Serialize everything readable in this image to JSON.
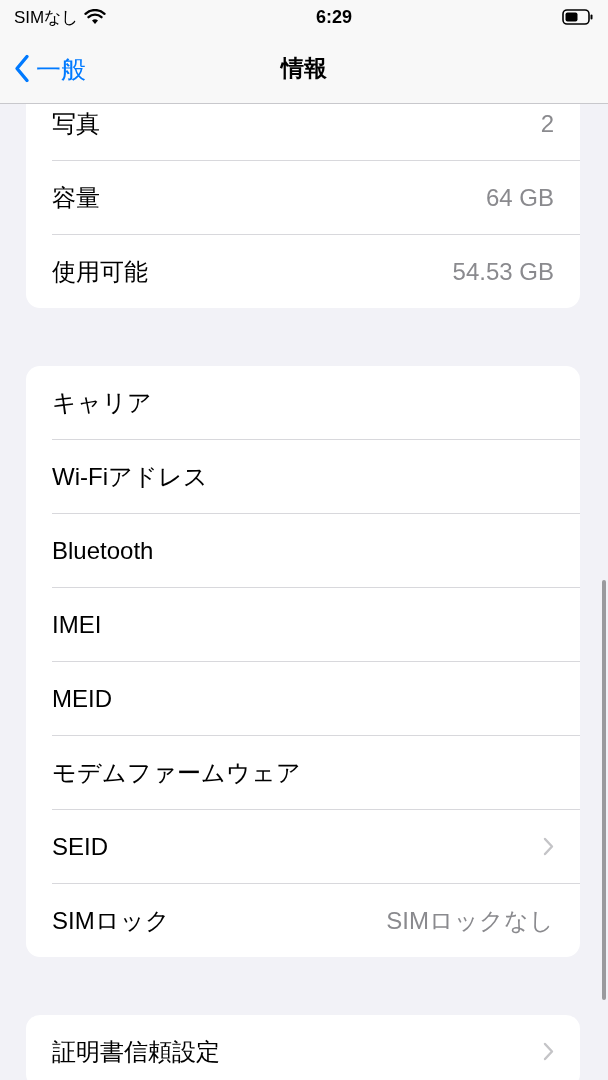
{
  "status_bar": {
    "carrier": "SIMなし",
    "time": "6:29"
  },
  "nav": {
    "back": "一般",
    "title": "情報"
  },
  "groups": [
    {
      "rows": [
        {
          "label": "写真",
          "value": "2",
          "chevron": false
        },
        {
          "label": "容量",
          "value": "64 GB",
          "chevron": false
        },
        {
          "label": "使用可能",
          "value": "54.53 GB",
          "chevron": false
        }
      ]
    },
    {
      "rows": [
        {
          "label": "キャリア",
          "chevron": false
        },
        {
          "label": "Wi-Fiアドレス",
          "chevron": false
        },
        {
          "label": "Bluetooth",
          "chevron": false
        },
        {
          "label": "IMEI",
          "chevron": false
        },
        {
          "label": "MEID",
          "chevron": false
        },
        {
          "label": "モデムファームウェア",
          "chevron": false
        },
        {
          "label": "SEID",
          "chevron": true
        },
        {
          "label": "SIMロック",
          "value": "SIMロックなし",
          "chevron": false
        }
      ]
    },
    {
      "rows": [
        {
          "label": "証明書信頼設定",
          "chevron": true
        }
      ]
    }
  ]
}
